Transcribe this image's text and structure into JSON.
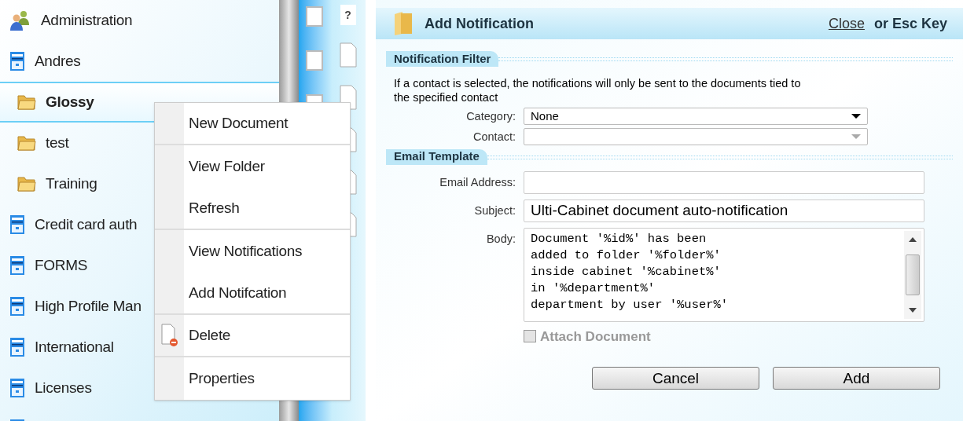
{
  "tree": {
    "items": [
      {
        "label": "Administration",
        "kind": "group",
        "selected": false
      },
      {
        "label": "Andres",
        "kind": "cabinet",
        "selected": false,
        "children": [
          {
            "label": "Glossy",
            "kind": "folder",
            "selected": true
          },
          {
            "label": "test",
            "kind": "folder",
            "selected": false
          },
          {
            "label": "Training",
            "kind": "folder",
            "selected": false
          }
        ]
      },
      {
        "label": "Credit card auth",
        "kind": "cabinet",
        "selected": false
      },
      {
        "label": "FORMS",
        "kind": "cabinet",
        "selected": false
      },
      {
        "label": "High Profile Man",
        "kind": "cabinet",
        "selected": false
      },
      {
        "label": "International",
        "kind": "cabinet",
        "selected": false
      },
      {
        "label": "Licenses",
        "kind": "cabinet",
        "selected": false
      },
      {
        "kind": "cabinet",
        "selected": false
      }
    ]
  },
  "strip": {
    "help_mark": "?"
  },
  "context_menu": {
    "items": [
      {
        "label": "New Document",
        "kind": "plain",
        "separator_after": true
      },
      {
        "label": "View Folder",
        "kind": "plain",
        "separator_after": false
      },
      {
        "label": "Refresh",
        "kind": "plain",
        "separator_after": true
      },
      {
        "label": "View Notifications",
        "kind": "plain",
        "separator_after": false
      },
      {
        "label": "Add Notifcation",
        "kind": "plain",
        "separator_after": true
      },
      {
        "label": "Delete",
        "kind": "delete",
        "separator_after": true
      },
      {
        "label": "Properties",
        "kind": "plain",
        "separator_after": false
      }
    ]
  },
  "dialog": {
    "title": "Add Notification",
    "close_link": "Close",
    "close_hint": "or Esc Key",
    "sections": [
      {
        "title": "Notification Filter",
        "note": "If a contact is selected, the notifications will only be sent to the documents tied to the specified contact",
        "fields": [
          {
            "label": "Category:",
            "kind": "select",
            "value": "None",
            "disabled": false
          },
          {
            "label": "Contact:",
            "kind": "select",
            "disabled": true
          }
        ]
      },
      {
        "title": "Email Template",
        "fields": [
          {
            "label": "Email Address:",
            "kind": "text"
          },
          {
            "label": "Subject:",
            "kind": "text",
            "value": "Ulti-Cabinet document auto-notification"
          },
          {
            "label": "Body:",
            "kind": "textarea",
            "value": "Document '%id%' has been\nadded to folder '%folder%'\ninside cabinet '%cabinet%'\nin '%department%'\ndepartment by user '%user%'"
          }
        ]
      }
    ],
    "attach": {
      "label": "Attach Document",
      "checked": false,
      "disabled": true
    },
    "buttons": [
      "Cancel",
      "Add"
    ]
  }
}
